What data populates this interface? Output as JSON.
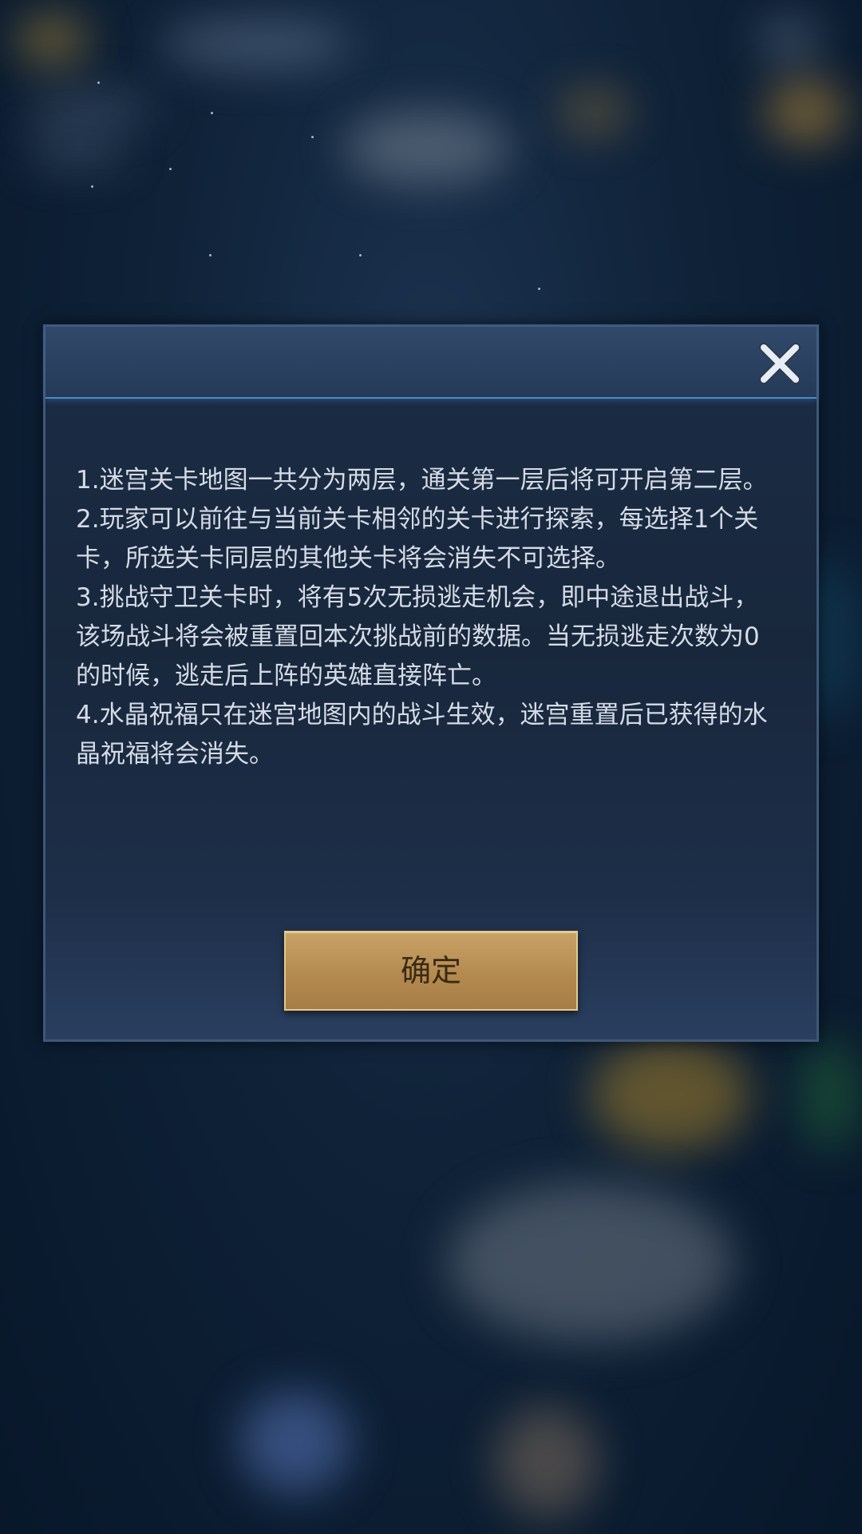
{
  "dialog": {
    "close_icon": "close-icon",
    "rules": [
      "1.迷宫关卡地图一共分为两层，通关第一层后将可开启第二层。",
      "2.玩家可以前往与当前关卡相邻的关卡进行探索，每选择1个关卡，所选关卡同层的其他关卡将会消失不可选择。",
      "3.挑战守卫关卡时，将有5次无损逃走机会，即中途退出战斗，该场战斗将会被重置回本次挑战前的数据。当无损逃走次数为0的时候，逃走后上阵的英雄直接阵亡。",
      "4.水晶祝福只在迷宫地图内的战斗生效，迷宫重置后已获得的水晶祝福将会消失。"
    ],
    "confirm_label": "确定"
  },
  "colors": {
    "text": "#d5dbe6",
    "header_accent": "#4b8cc4",
    "button_gold": "#b48a50"
  }
}
